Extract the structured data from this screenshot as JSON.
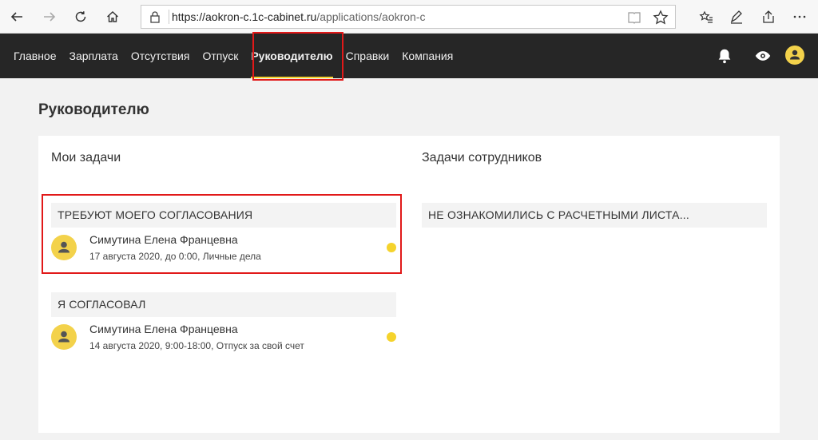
{
  "browser": {
    "url_main": "https://aokron-c.1c-cabinet.ru",
    "url_path": "/applications/aokron-c"
  },
  "nav": {
    "items": [
      "Главное",
      "Зарплата",
      "Отсутствия",
      "Отпуск",
      "Руководителю",
      "Справки",
      "Компания"
    ],
    "active": "Руководителю"
  },
  "page": {
    "title": "Руководителю"
  },
  "my_tasks": {
    "title": "Мои задачи",
    "sections": [
      {
        "header": "ТРЕБУЮТ МОЕГО СОГЛАСОВАНИЯ",
        "task": {
          "name": "Симутина Елена Францевна",
          "details": "17 августа 2020, до 0:00, Личные дела"
        }
      },
      {
        "header": "Я СОГЛАСОВАЛ",
        "task": {
          "name": "Симутина Елена Францевна",
          "details": "14 августа 2020, 9:00-18:00, Отпуск за свой счет"
        }
      }
    ]
  },
  "employee_tasks": {
    "title": "Задачи сотрудников",
    "sections": [
      {
        "header": "НЕ ОЗНАКОМИЛИСЬ С РАСЧЕТНЫМИ ЛИСТА..."
      }
    ]
  },
  "colors": {
    "accent": "#f5d32c",
    "nav_bg": "#262626",
    "highlight": "#e11919"
  }
}
